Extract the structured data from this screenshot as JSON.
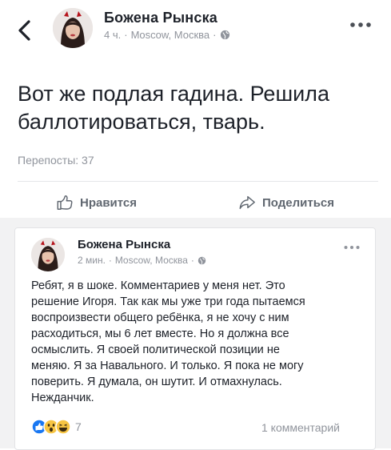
{
  "post1": {
    "author": "Божена Рынска",
    "time": "4 ч.",
    "separator": "·",
    "location": "Moscow, Москва",
    "separator2": "·",
    "text": "Вот же подлая гадина. Решила\nбаллотироваться, тварь.",
    "reposts": "Перепосты: 37",
    "like_label": "Нравится",
    "share_label": "Поделиться",
    "icons": [
      "chevron-left-icon",
      "globe-icon",
      "more-icon",
      "like-icon",
      "share-icon"
    ]
  },
  "post2": {
    "author": "Божена Рынска",
    "time": "2 мин.",
    "separator": "·",
    "location": "Moscow, Москва",
    "separator2": "·",
    "text": "Ребят, я в шоке. Комментариев у меня нет. Это\nрешение Игоря. Так как мы уже три года пытаемся\nвоспроизвести общего ребёнка, я не хочу с ним\nрасходиться, мы 6 лет вместе. Но я должна все\nосмыслить. Я своей политической позиции не\nменяю. Я за Навального. И только. Я пока не могу\nповерить. Я думала, он шутит. И отмахнулась.\nНежданчик.",
    "reaction_count": "7",
    "comments": "1 комментарий",
    "reactions": [
      "like-icon",
      "wow-icon",
      "haha-icon"
    ]
  },
  "colors": {
    "text": "#1d2129",
    "secondary": "#90949c",
    "like_blue": "#1877f2",
    "reaction_yellow": "#f7c543",
    "background_gap": "#f2f2f3"
  }
}
